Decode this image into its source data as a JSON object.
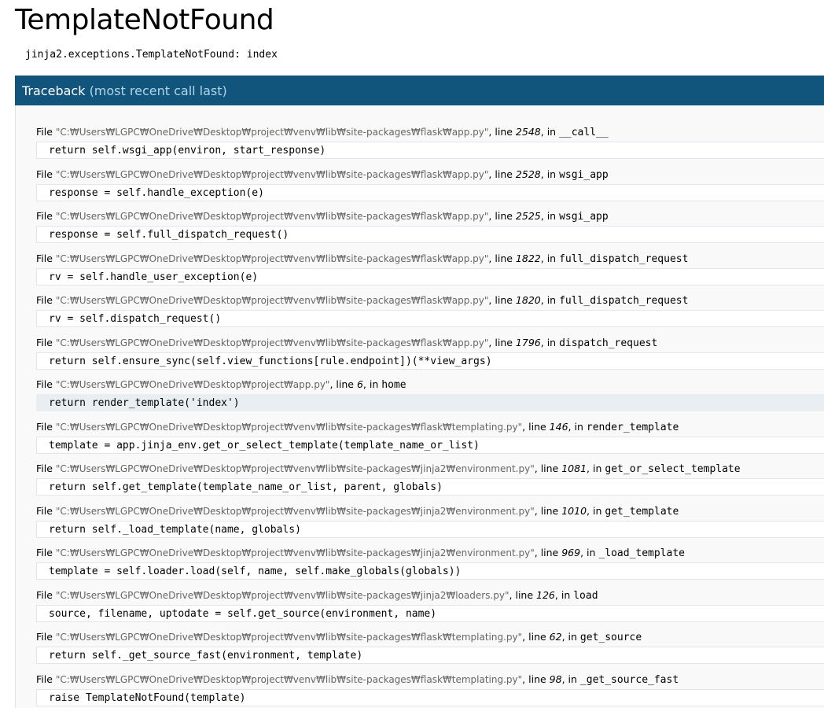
{
  "title": "TemplateNotFound",
  "error_message": "jinja2.exceptions.TemplateNotFound: index",
  "traceback_header": {
    "label": "Traceback",
    "sub": "(most recent call last)"
  },
  "file_prefix": "File",
  "line_word": "line",
  "in_word": "in",
  "frames": [
    {
      "path": "\"C:₩Users₩LGPC₩OneDrive₩Desktop₩project₩venv₩lib₩site-packages₩flask₩app.py\"",
      "line": "2548",
      "func": "__call__",
      "source": "return self.wsgi_app(environ, start_response)"
    },
    {
      "path": "\"C:₩Users₩LGPC₩OneDrive₩Desktop₩project₩venv₩lib₩site-packages₩flask₩app.py\"",
      "line": "2528",
      "func": "wsgi_app",
      "source": "response = self.handle_exception(e)"
    },
    {
      "path": "\"C:₩Users₩LGPC₩OneDrive₩Desktop₩project₩venv₩lib₩site-packages₩flask₩app.py\"",
      "line": "2525",
      "func": "wsgi_app",
      "source": "response = self.full_dispatch_request()"
    },
    {
      "path": "\"C:₩Users₩LGPC₩OneDrive₩Desktop₩project₩venv₩lib₩site-packages₩flask₩app.py\"",
      "line": "1822",
      "func": "full_dispatch_request",
      "source": "rv = self.handle_user_exception(e)"
    },
    {
      "path": "\"C:₩Users₩LGPC₩OneDrive₩Desktop₩project₩venv₩lib₩site-packages₩flask₩app.py\"",
      "line": "1820",
      "func": "full_dispatch_request",
      "source": "rv = self.dispatch_request()"
    },
    {
      "path": "\"C:₩Users₩LGPC₩OneDrive₩Desktop₩project₩venv₩lib₩site-packages₩flask₩app.py\"",
      "line": "1796",
      "func": "dispatch_request",
      "source": "return self.ensure_sync(self.view_functions[rule.endpoint])(**view_args)"
    },
    {
      "path": "\"C:₩Users₩LGPC₩OneDrive₩Desktop₩project₩app.py\"",
      "line": "6",
      "func": "home",
      "source": "return render_template('index')",
      "current": true
    },
    {
      "path": "\"C:₩Users₩LGPC₩OneDrive₩Desktop₩project₩venv₩lib₩site-packages₩flask₩templating.py\"",
      "line": "146",
      "func": "render_template",
      "source": "template = app.jinja_env.get_or_select_template(template_name_or_list)"
    },
    {
      "path": "\"C:₩Users₩LGPC₩OneDrive₩Desktop₩project₩venv₩lib₩site-packages₩jinja2₩environment.py\"",
      "line": "1081",
      "func": "get_or_select_template",
      "source": "return self.get_template(template_name_or_list, parent, globals)"
    },
    {
      "path": "\"C:₩Users₩LGPC₩OneDrive₩Desktop₩project₩venv₩lib₩site-packages₩jinja2₩environment.py\"",
      "line": "1010",
      "func": "get_template",
      "source": "return self._load_template(name, globals)"
    },
    {
      "path": "\"C:₩Users₩LGPC₩OneDrive₩Desktop₩project₩venv₩lib₩site-packages₩jinja2₩environment.py\"",
      "line": "969",
      "func": "_load_template",
      "source": "template = self.loader.load(self, name, self.make_globals(globals))"
    },
    {
      "path": "\"C:₩Users₩LGPC₩OneDrive₩Desktop₩project₩venv₩lib₩site-packages₩jinja2₩loaders.py\"",
      "line": "126",
      "func": "load",
      "source": "source, filename, uptodate = self.get_source(environment, name)"
    },
    {
      "path": "\"C:₩Users₩LGPC₩OneDrive₩Desktop₩project₩venv₩lib₩site-packages₩flask₩templating.py\"",
      "line": "62",
      "func": "get_source",
      "source": "return self._get_source_fast(environment, template)"
    },
    {
      "path": "\"C:₩Users₩LGPC₩OneDrive₩Desktop₩project₩venv₩lib₩site-packages₩flask₩templating.py\"",
      "line": "98",
      "func": "_get_source_fast",
      "source": "raise TemplateNotFound(template)"
    }
  ]
}
